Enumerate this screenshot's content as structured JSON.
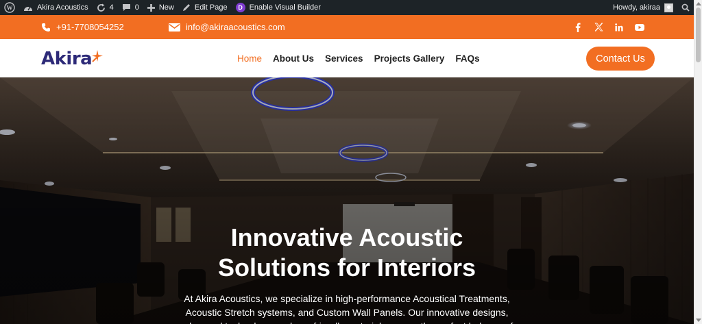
{
  "adminbar": {
    "site_name": "Akira Acoustics",
    "updates_count": "4",
    "comments_count": "0",
    "new_label": "New",
    "edit_label": "Edit Page",
    "divi_label": "Enable Visual Builder",
    "divi_letter": "D",
    "howdy": "Howdy, akiraa"
  },
  "topbar": {
    "phone": "+91-7708054252",
    "email": "info@akiraacoustics.com",
    "socials": [
      "facebook-icon",
      "x-icon",
      "linkedin-icon",
      "youtube-icon"
    ]
  },
  "header": {
    "logo_text": "Akira",
    "nav": [
      "Home",
      "About Us",
      "Services",
      "Projects Gallery",
      "FAQs"
    ],
    "active_nav": "Home",
    "cta": "Contact Us"
  },
  "hero": {
    "title_line1": "Innovative Acoustic",
    "title_line2": "Solutions for Interiors",
    "text": "At Akira Acoustics, we specialize in high-performance Acoustical Treatments, Acoustic Stretch systems, and Custom Wall Panels. Our innovative designs, advanced technology, and eco-friendly materials ensure the perfect balance of"
  },
  "colors": {
    "accent": "#f26e22",
    "brand": "#2d2a78",
    "adminbar": "#1d2327"
  }
}
